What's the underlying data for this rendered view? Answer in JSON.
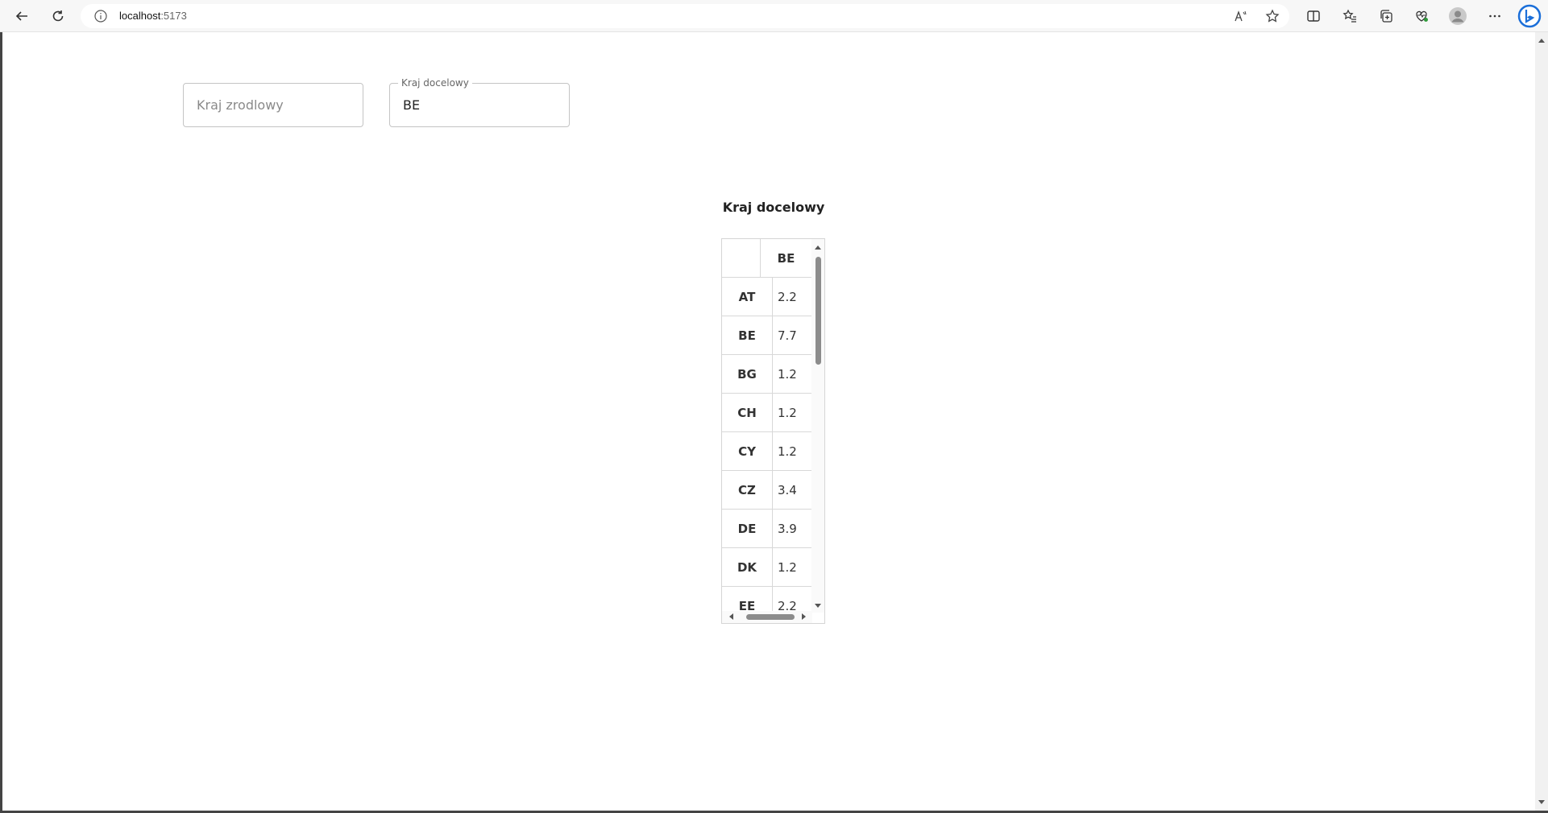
{
  "browser": {
    "url_host": "localhost",
    "url_port": ":5173"
  },
  "form": {
    "source_country": {
      "placeholder": "Kraj zrodlowy",
      "value": ""
    },
    "target_country": {
      "label": "Kraj docelowy",
      "value": "BE"
    }
  },
  "table": {
    "title": "Kraj docelowy",
    "column_header": "BE",
    "rows": [
      {
        "key": "AT",
        "value": "2.2"
      },
      {
        "key": "BE",
        "value": "7.7"
      },
      {
        "key": "BG",
        "value": "1.2"
      },
      {
        "key": "CH",
        "value": "1.2"
      },
      {
        "key": "CY",
        "value": "1.2"
      },
      {
        "key": "CZ",
        "value": "3.4"
      },
      {
        "key": "DE",
        "value": "3.9"
      },
      {
        "key": "DK",
        "value": "1.2"
      },
      {
        "key": "EE",
        "value": "2.2"
      }
    ]
  }
}
